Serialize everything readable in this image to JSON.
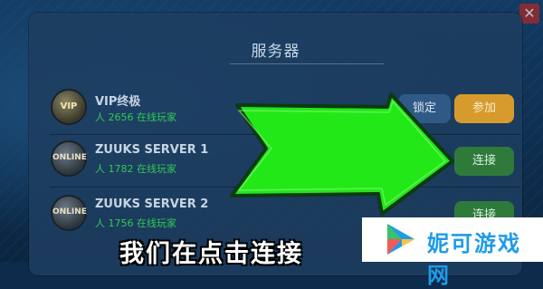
{
  "dialog": {
    "title": "服务器",
    "close_symbol": "✕"
  },
  "servers": [
    {
      "name": "VIP终极",
      "players": "人 2656 在线玩家",
      "badge": "VIP",
      "actions": [
        "锁定",
        "参加"
      ]
    },
    {
      "name": "ZUUKS SERVER 1",
      "players": "人 1782 在线玩家",
      "badge": "ONLINE",
      "actions": [
        "连接"
      ]
    },
    {
      "name": "ZUUKS SERVER 2",
      "players": "人 1756 在线玩家",
      "badge": "ONLINE",
      "actions": [
        "连接"
      ]
    }
  ],
  "caption": "我们在点击连接",
  "watermark": {
    "text": "妮可游戏网"
  },
  "colors": {
    "arrow": "#22e818",
    "join": "#d69b2c",
    "connect": "#2f7a3b",
    "players": "#31c955"
  }
}
